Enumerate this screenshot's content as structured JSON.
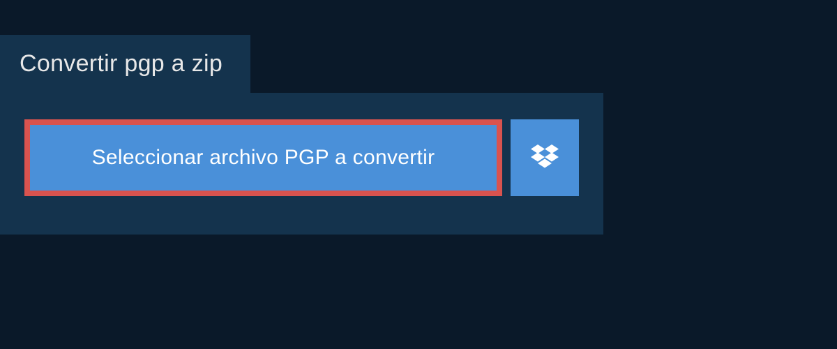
{
  "tab": {
    "title": "Convertir pgp a zip"
  },
  "actions": {
    "select_file_label": "Seleccionar archivo PGP a convertir",
    "dropbox_icon": "dropbox"
  }
}
